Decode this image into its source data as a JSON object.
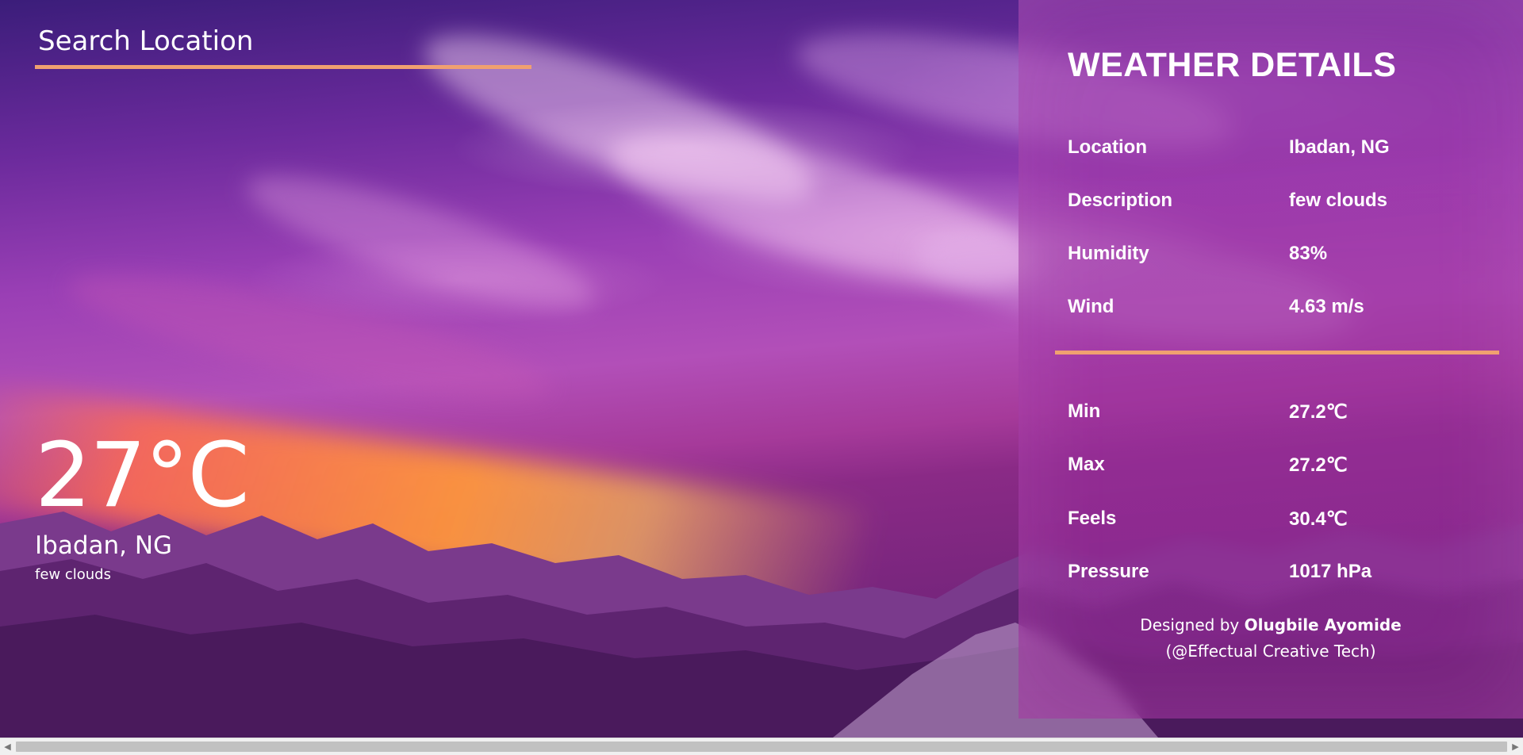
{
  "search": {
    "placeholder": "Search Location"
  },
  "current": {
    "temperature": "27°C",
    "city": "Ibadan, NG",
    "description": "few clouds"
  },
  "details": {
    "title": "WEATHER DETAILS",
    "rows": [
      {
        "label": "Location",
        "value": "Ibadan, NG"
      },
      {
        "label": "Description",
        "value": "few clouds"
      },
      {
        "label": "Humidity",
        "value": "83%"
      },
      {
        "label": "Wind",
        "value": "4.63 m/s"
      },
      {
        "label": "Min",
        "value": "27.2℃"
      },
      {
        "label": "Max",
        "value": "27.2℃"
      },
      {
        "label": "Feels",
        "value": "30.4℃"
      },
      {
        "label": "Pressure",
        "value": "1017 hPa"
      }
    ],
    "credit_prefix": "Designed by",
    "credit_name": "Olugbile Ayomide",
    "credit_handle": "(@Effectual Creative Tech)"
  },
  "scrollbar": {
    "left_arrow": "◀",
    "right_arrow": "▶"
  },
  "colors": {
    "accent_underline": "#f0a070",
    "text": "#ffffff"
  }
}
